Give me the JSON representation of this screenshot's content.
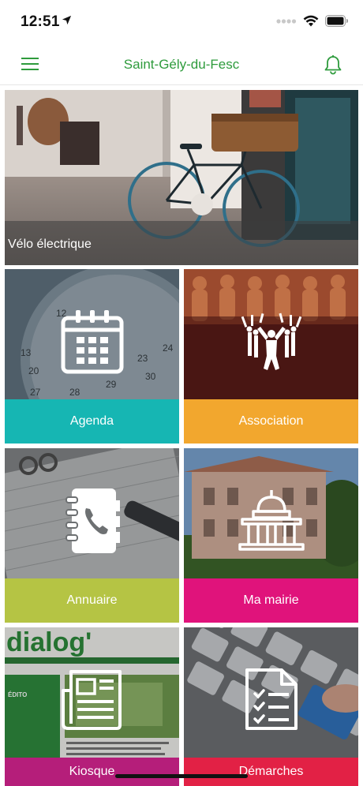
{
  "status_bar": {
    "time": "12:51"
  },
  "nav": {
    "title": "Saint-Gély-du-Fesc"
  },
  "hero": {
    "caption": "Vélo électrique"
  },
  "tiles": [
    {
      "label": "Agenda",
      "color": "#16b6b3",
      "icon": "calendar-icon"
    },
    {
      "label": "Association",
      "color": "#f2a72e",
      "icon": "people-celebrating-icon"
    },
    {
      "label": "Annuaire",
      "color": "#b5c444",
      "icon": "phone-book-icon"
    },
    {
      "label": "Ma mairie",
      "color": "#e0137b",
      "icon": "town-hall-icon"
    },
    {
      "label": "Kiosque",
      "color": "#b51e7a",
      "icon": "newspaper-icon"
    },
    {
      "label": "Démarches",
      "color": "#e22145",
      "icon": "checklist-document-icon"
    }
  ],
  "kiosque_cover": {
    "masthead": "dialog'",
    "issue_heading": "ÉDITO"
  },
  "colors": {
    "brand_green": "#2e9b3c"
  }
}
